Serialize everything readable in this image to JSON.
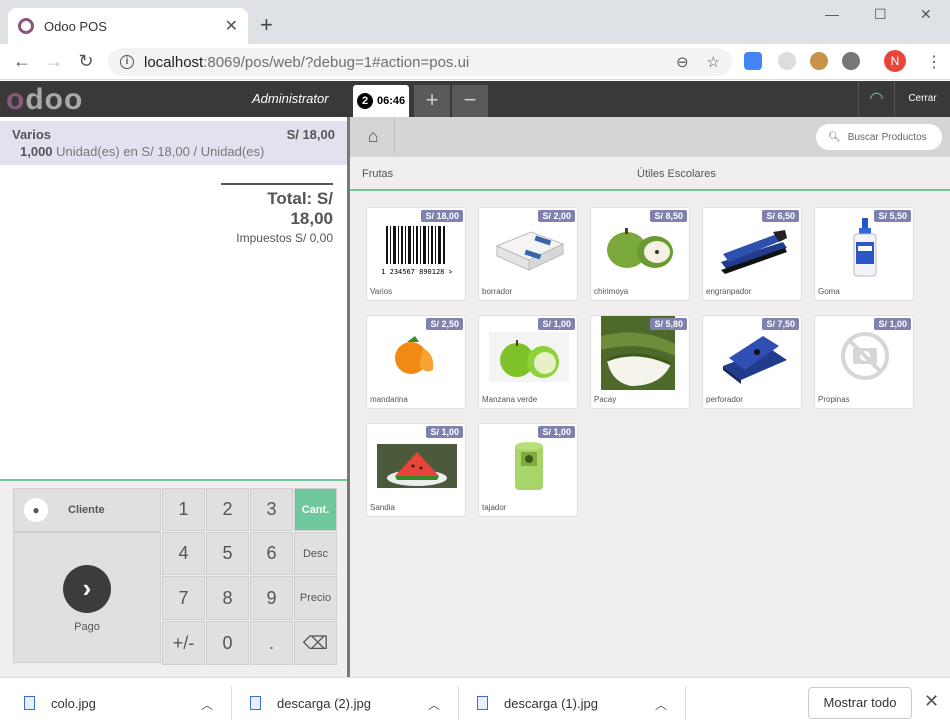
{
  "browser": {
    "tab_title": "Odoo POS",
    "url_host": "localhost",
    "url_rest": ":8069/pos/web/?debug=1#action=pos.ui",
    "profile_initial": "N"
  },
  "pos": {
    "logo": "odoo",
    "user": "Administrator",
    "order": {
      "number": "2",
      "time": "06:46"
    },
    "close_label": "Cerrar",
    "search_placeholder": "Buscar Productos",
    "categories": [
      "Frutas",
      "Útiles Escolares"
    ],
    "orderline": {
      "name": "Varios",
      "price": "S/ 18,00",
      "qty": "1,000",
      "info": " Unidad(es) en S/ 18,00 / Unidad(es)"
    },
    "totals": {
      "total": "Total: S/ 18,00",
      "taxes": "Impuestos S/ 0,00"
    },
    "pad": {
      "customer": "Cliente",
      "payment": "Pago",
      "keys": [
        "1",
        "2",
        "3",
        "Cant.",
        "4",
        "5",
        "6",
        "Desc",
        "7",
        "8",
        "9",
        "Precio",
        "+/-",
        "0",
        ".",
        "⌫"
      ]
    },
    "products": [
      {
        "name": "Varios",
        "price": "S/ 18,00",
        "icon": "barcode-icon"
      },
      {
        "name": "borrador",
        "price": "S/ 2,00",
        "icon": "eraser-icon"
      },
      {
        "name": "chirimoya",
        "price": "S/ 8,50",
        "icon": "fruit-icon"
      },
      {
        "name": "engranpador",
        "price": "S/ 6,50",
        "icon": "stapler-icon"
      },
      {
        "name": "Goma",
        "price": "S/ 5,50",
        "icon": "glue-icon"
      },
      {
        "name": "mandarina",
        "price": "S/ 2,50",
        "icon": "tangerine-icon"
      },
      {
        "name": "Manzana verde",
        "price": "S/ 1,00",
        "icon": "apple-icon"
      },
      {
        "name": "Pacay",
        "price": "S/ 5,80",
        "icon": "pod-icon"
      },
      {
        "name": "perforador",
        "price": "S/ 7,50",
        "icon": "hole-punch-icon"
      },
      {
        "name": "Propinas",
        "price": "S/ 1,00",
        "icon": "no-image-icon"
      },
      {
        "name": "Sandia",
        "price": "S/ 1,00",
        "icon": "watermelon-icon"
      },
      {
        "name": "tajador",
        "price": "S/ 1,00",
        "icon": "sharpener-icon"
      }
    ]
  },
  "downloads": {
    "items": [
      "colo.jpg",
      "descarga (2).jpg",
      "descarga (1).jpg"
    ],
    "show_all": "Mostrar todo"
  },
  "colors": {
    "accent": "#6ec89b",
    "brand": "#875a7b",
    "price_tag": "#7f82ac"
  }
}
